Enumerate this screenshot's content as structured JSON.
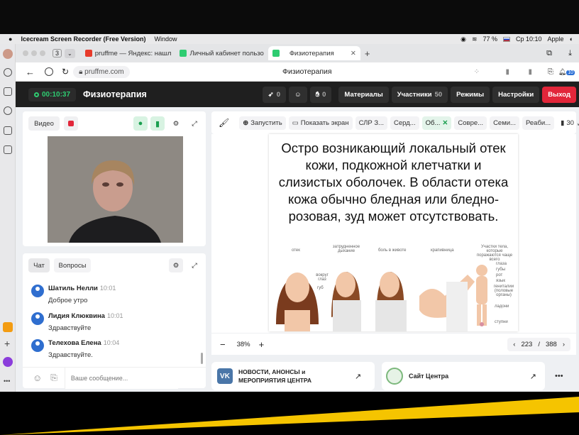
{
  "menubar": {
    "app": "Icecream Screen Recorder (Free Version)",
    "menu_window": "Window",
    "battery": "77 %",
    "clock": "Ср 10:10",
    "user": "Apple"
  },
  "tabs": [
    {
      "label": "pruffme — Яндекс: нашл",
      "icon": "yandex-icon",
      "color": "#e73b2b"
    },
    {
      "label": "Личный кабинет пользо",
      "icon": "pruffme-icon",
      "color": "#2ecc71"
    },
    {
      "label": "Физиотерапия",
      "icon": "pruffme-icon",
      "color": "#2ecc71"
    }
  ],
  "tab_count": "3",
  "address": {
    "url": "pruffme.com",
    "page_title": "Физиотерапия"
  },
  "badge_count": "10",
  "header": {
    "timer": "00:10:37",
    "title": "Физиотерапия",
    "rocket_count": "0",
    "hand_count": "0",
    "materials": "Материалы",
    "participants": "Участники",
    "participants_count": "50",
    "modes": "Режимы",
    "settings": "Настройки",
    "exit": "Выход"
  },
  "video_panel": {
    "video_label": "Видео"
  },
  "chat": {
    "tab_chat": "Чат",
    "tab_questions": "Вопросы",
    "placeholder": "Ваше сообщение...",
    "messages": [
      {
        "name": "Шатиль Нелли",
        "time": "10:01",
        "text": "Доброе утро"
      },
      {
        "name": "Лидия Клюквина",
        "time": "10:01",
        "text": "Здравствуйте"
      },
      {
        "name": "Телехова Елена",
        "time": "10:04",
        "text": "Здравствуйте."
      }
    ]
  },
  "toolbar": {
    "launch": "Запустить",
    "show_screen": "Показать экран",
    "tabs": [
      "СЛР З...",
      "Серд...",
      "Об...",
      "Совре...",
      "Семи...",
      "Реаби..."
    ],
    "bookmark_count": "30"
  },
  "slide": {
    "text": "Остро возникающий локальный отек кожи, подкожной клетчатки и слизистых оболочек. В области отека кожа обычно бледная или бледно-розовая, зуд может отсутствовать.",
    "labels": [
      "отек",
      "затрудненное дыхание",
      "боль в животе",
      "крапивница",
      "Участки тела, которые поражаются чаще всего",
      "вокруг глаз",
      "губ",
      "глаза",
      "губы",
      "рот",
      "язык",
      "гениталии (половые органы)",
      "ладони",
      "ступни"
    ]
  },
  "zoom": {
    "value": "38%",
    "page": "223",
    "total": "388"
  },
  "cards": {
    "news": "НОВОСТИ, АНОНСЫ и МЕРОПРИЯТИЯ ЦЕНТРА",
    "site": "Сайт Центра",
    "more": "•••"
  },
  "colors": {
    "accent": "#2ecc71",
    "exit": "#e2263a",
    "vk": "#4a76a8",
    "stripe": "#f5c400"
  }
}
